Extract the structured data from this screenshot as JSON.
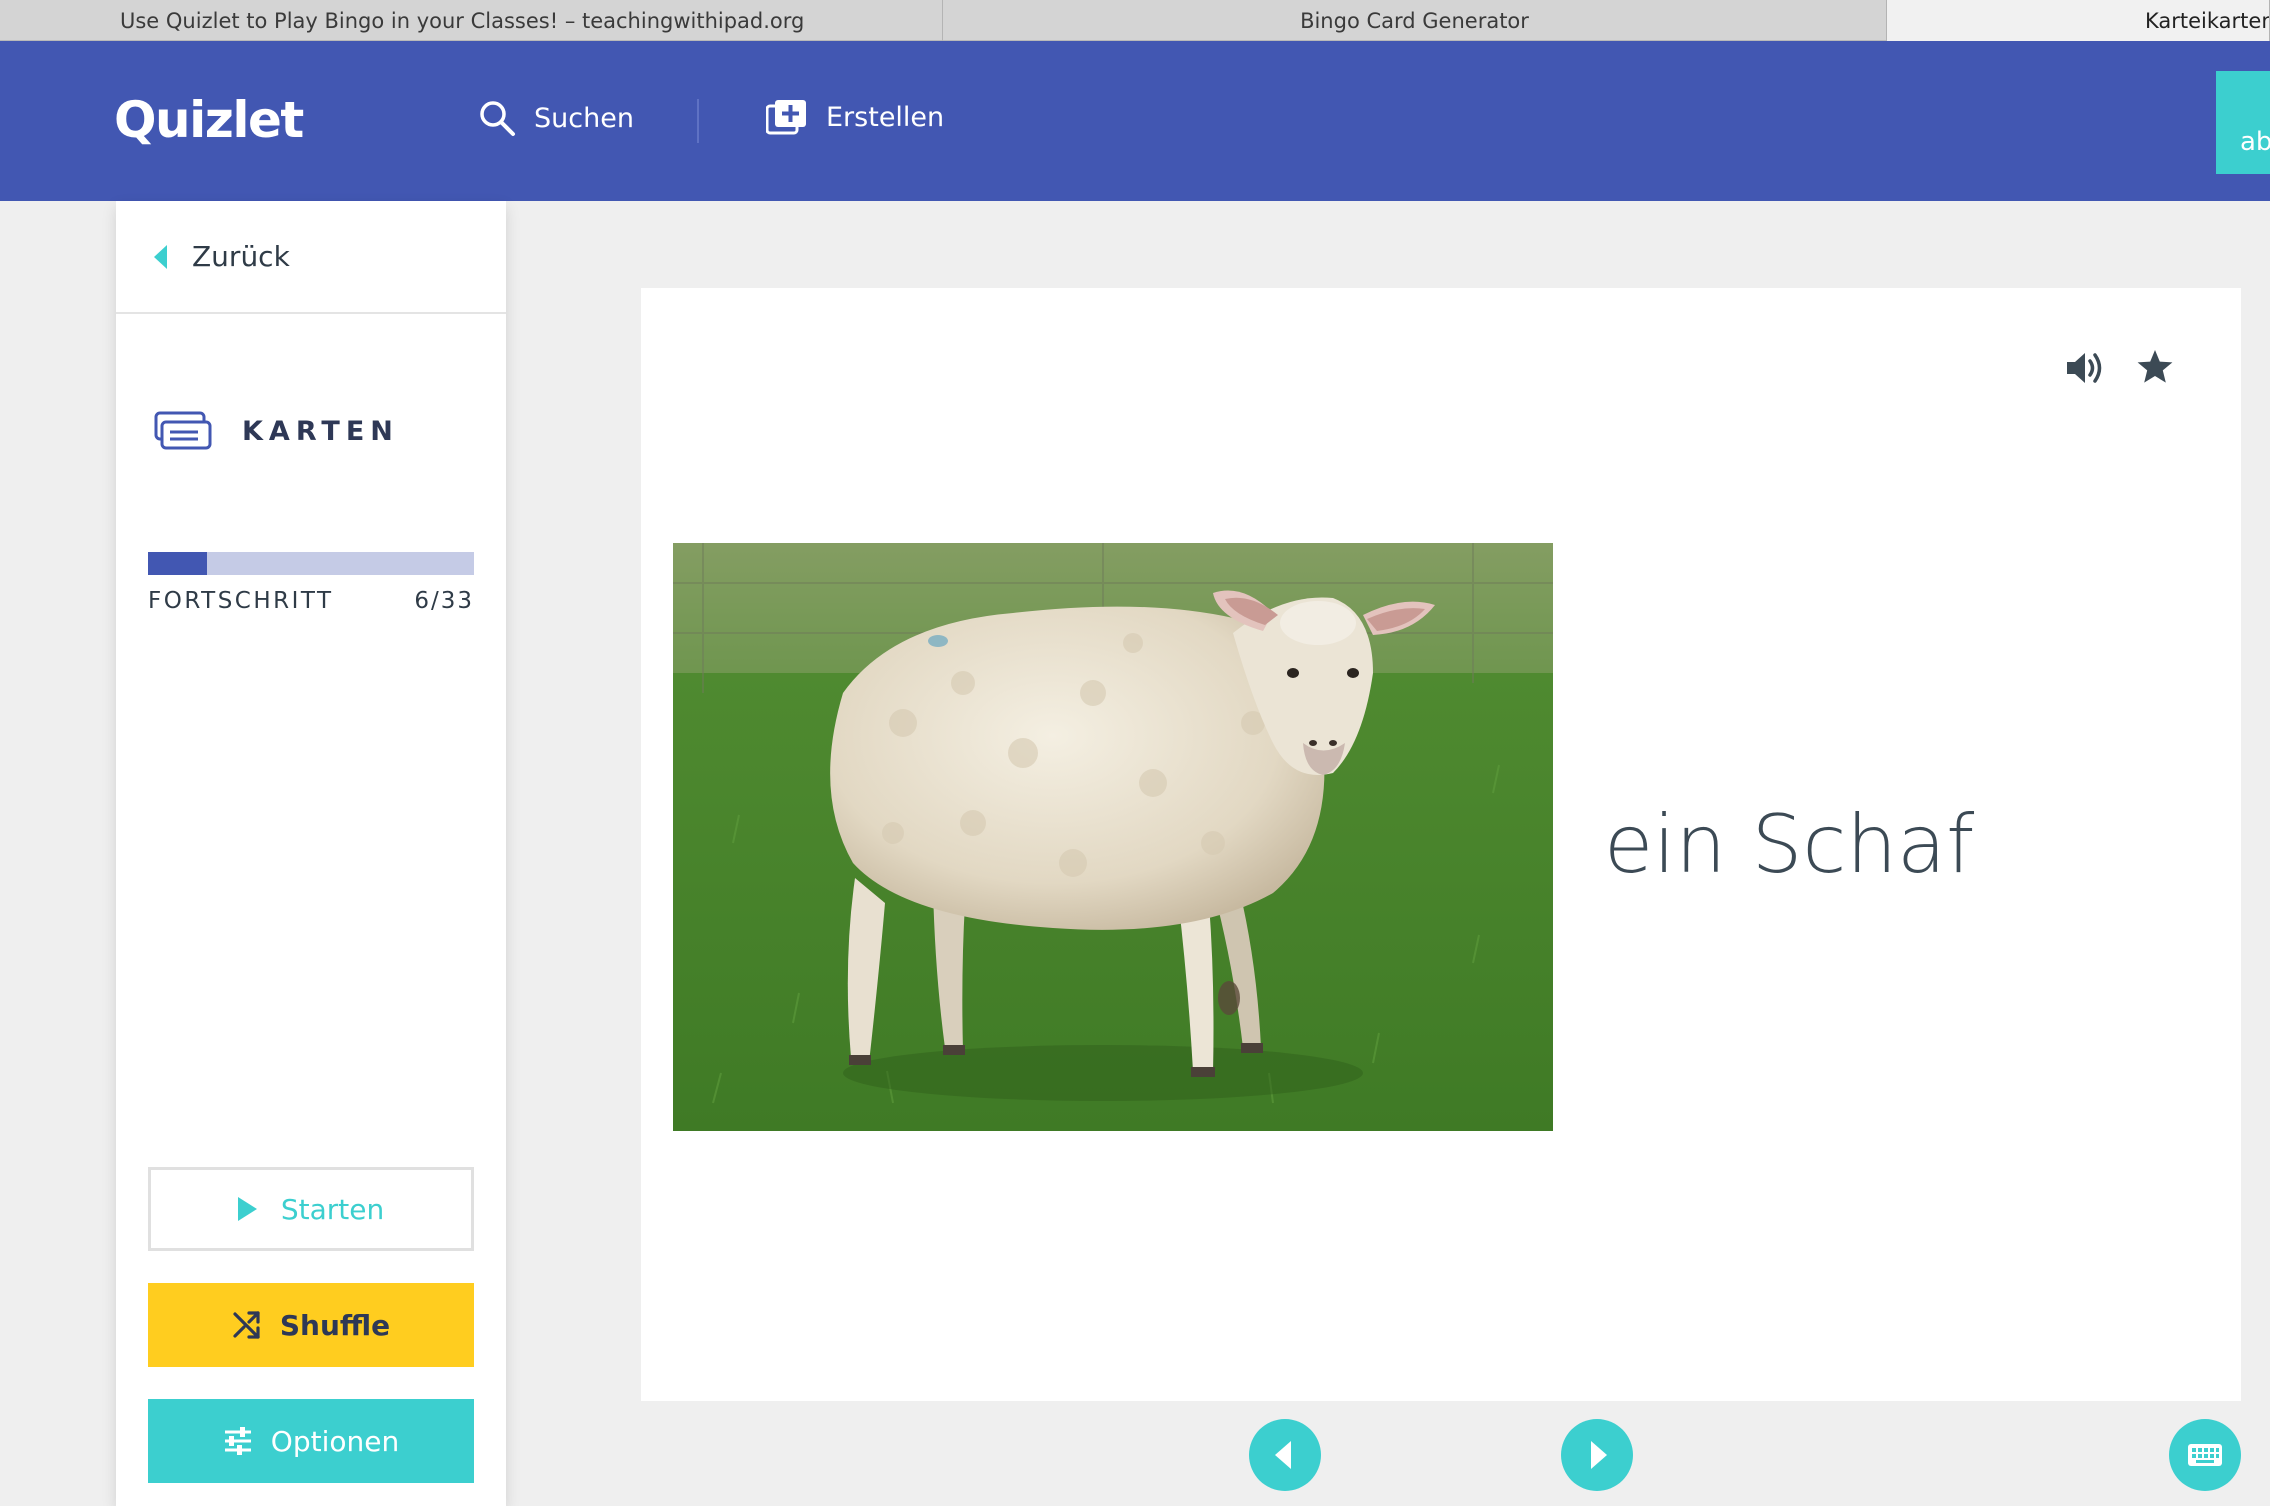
{
  "browser": {
    "tabs": [
      {
        "title": "Use Quizlet to Play Bingo in your Classes! – teachingwithipad.org"
      },
      {
        "title": "Bingo Card Generator"
      },
      {
        "title": "Karteikarten"
      }
    ]
  },
  "header": {
    "logo": "Quizlet",
    "search_label": "Suchen",
    "create_label": "Erstellen",
    "right_button_label": "ab"
  },
  "sidebar": {
    "back_label": "Zurück",
    "mode_label": "KARTEN",
    "progress": {
      "label": "FORTSCHRITT",
      "current": 6,
      "total": 33,
      "text": "6/33"
    },
    "buttons": {
      "start": "Starten",
      "shuffle": "Shuffle",
      "options": "Optionen"
    }
  },
  "card": {
    "term": "ein Schaf",
    "image_icon": "sheep-photo"
  },
  "icons": {
    "search": "search-icon",
    "create": "add-set-icon",
    "cards": "cards-icon",
    "audio": "speaker-icon",
    "star": "star-icon",
    "shuffle": "shuffle-icon",
    "options": "sliders-icon",
    "prev": "chevron-left-icon",
    "next": "chevron-right-icon",
    "keyboard": "keyboard-icon"
  },
  "colors": {
    "brand_blue": "#4257b2",
    "accent_teal": "#3ccfcf",
    "shuffle_yellow": "#ffcd1f",
    "progress_track": "#c5cbe6"
  }
}
